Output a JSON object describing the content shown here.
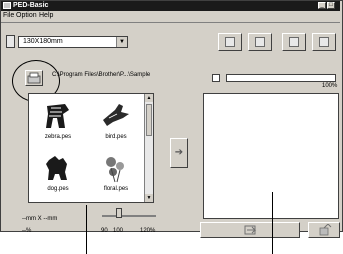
{
  "window": {
    "title": "PED-Basic"
  },
  "menu": {
    "items": [
      "File",
      "Option",
      "Help"
    ]
  },
  "toolbar": {
    "size_select": "130X180mm"
  },
  "browser": {
    "path": "C:\\Program Files\\Brother\\P...\\Sample",
    "files": [
      {
        "name": "zebra.pes",
        "icon": "zebra-icon"
      },
      {
        "name": "bird.pes",
        "icon": "bird-icon"
      },
      {
        "name": "dog.pes",
        "icon": "dog-icon"
      },
      {
        "name": "floral.pes",
        "icon": "floral-icon"
      }
    ]
  },
  "preview": {
    "percent_label": "100%",
    "progress": 0
  },
  "zoom": {
    "size_label": "--mm X --mm",
    "percent_label": "--%",
    "ticks": [
      "90",
      "100",
      "120%"
    ],
    "level": 100
  },
  "colors": {
    "titlebar": "#1a1a1a",
    "window_bg": "#d4d0c8"
  }
}
